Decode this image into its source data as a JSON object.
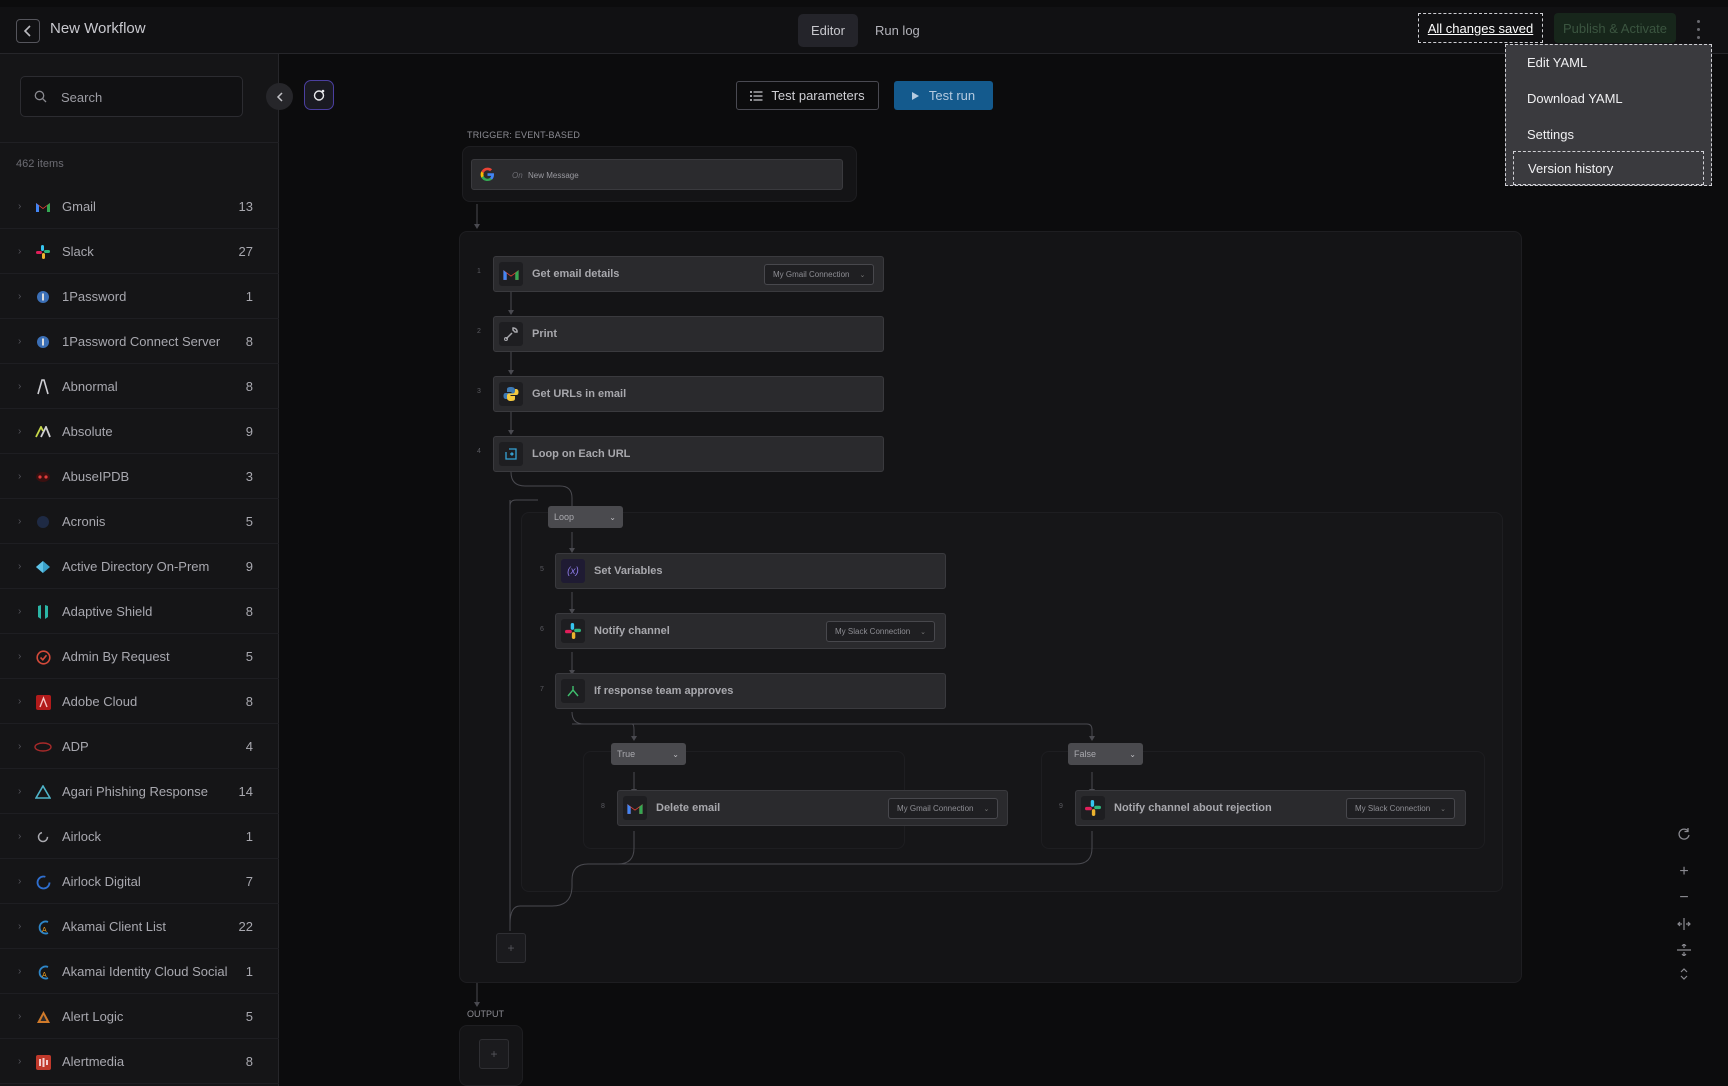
{
  "header": {
    "title": "New Workflow",
    "tabs": [
      {
        "label": "Editor"
      },
      {
        "label": "Run log"
      }
    ],
    "saved_label": "All changes saved",
    "publish_label": "Publish & Activate"
  },
  "menu": {
    "items": [
      {
        "label": "Edit YAML"
      },
      {
        "label": "Download YAML"
      },
      {
        "label": "Settings"
      },
      {
        "label": "Version history"
      }
    ]
  },
  "sidebar": {
    "search_placeholder": "Search",
    "count_label": "462 items",
    "items": [
      {
        "name": "Gmail",
        "count": "13",
        "icon": "gmail-icon"
      },
      {
        "name": "Slack",
        "count": "27",
        "icon": "slack-icon"
      },
      {
        "name": "1Password",
        "count": "1",
        "icon": "1password-icon"
      },
      {
        "name": "1Password Connect Server",
        "count": "8",
        "icon": "1password-icon"
      },
      {
        "name": "Abnormal",
        "count": "8",
        "icon": "abnormal-icon"
      },
      {
        "name": "Absolute",
        "count": "9",
        "icon": "absolute-icon"
      },
      {
        "name": "AbuseIPDB",
        "count": "3",
        "icon": "abuseipdb-icon"
      },
      {
        "name": "Acronis",
        "count": "5",
        "icon": "acronis-icon"
      },
      {
        "name": "Active Directory On-Prem",
        "count": "9",
        "icon": "active-directory-icon"
      },
      {
        "name": "Adaptive Shield",
        "count": "8",
        "icon": "adaptive-shield-icon"
      },
      {
        "name": "Admin By Request",
        "count": "5",
        "icon": "admin-by-request-icon"
      },
      {
        "name": "Adobe Cloud",
        "count": "8",
        "icon": "adobe-icon"
      },
      {
        "name": "ADP",
        "count": "4",
        "icon": "adp-icon"
      },
      {
        "name": "Agari Phishing Response",
        "count": "14",
        "icon": "agari-icon"
      },
      {
        "name": "Airlock",
        "count": "1",
        "icon": "airlock-icon"
      },
      {
        "name": "Airlock Digital",
        "count": "7",
        "icon": "airlock-digital-icon"
      },
      {
        "name": "Akamai Client List",
        "count": "22",
        "icon": "akamai-icon"
      },
      {
        "name": "Akamai Identity Cloud Social",
        "count": "1",
        "icon": "akamai-icon"
      },
      {
        "name": "Alert Logic",
        "count": "5",
        "icon": "alert-logic-icon"
      },
      {
        "name": "Alertmedia",
        "count": "8",
        "icon": "alertmedia-icon"
      }
    ]
  },
  "canvas": {
    "test_params_label": "Test parameters",
    "test_run_label": "Test run",
    "trigger_label": "TRIGGER: EVENT-BASED",
    "trigger_on": "On",
    "trigger_event": "New Message",
    "output_label": "OUTPUT",
    "steps": [
      {
        "num": "1",
        "label": "Get email details",
        "connection": "My Gmail Connection",
        "icon": "gmail-icon"
      },
      {
        "num": "2",
        "label": "Print",
        "icon": "wrench-icon"
      },
      {
        "num": "3",
        "label": "Get URLs in email",
        "icon": "python-icon"
      },
      {
        "num": "4",
        "label": "Loop on Each URL",
        "icon": "loop-icon"
      },
      {
        "num": "5",
        "label": "Set Variables",
        "icon": "variables-icon"
      },
      {
        "num": "6",
        "label": "Notify channel",
        "connection": "My Slack Connection",
        "icon": "slack-icon"
      },
      {
        "num": "7",
        "label": "If response team approves",
        "icon": "branch-icon"
      },
      {
        "num": "8",
        "label": "Delete email",
        "connection": "My Gmail Connection",
        "icon": "gmail-icon"
      },
      {
        "num": "9",
        "label": "Notify channel about rejection",
        "connection": "My Slack Connection",
        "icon": "slack-icon"
      }
    ],
    "loop_pill": "Loop",
    "true_pill": "True",
    "false_pill": "False",
    "plus": "+"
  },
  "colors": {
    "accent_blue": "#145a8d",
    "background": "#0c0c0d",
    "sidebar_bg": "#151517",
    "menu_bg": "#3a3a3e"
  }
}
